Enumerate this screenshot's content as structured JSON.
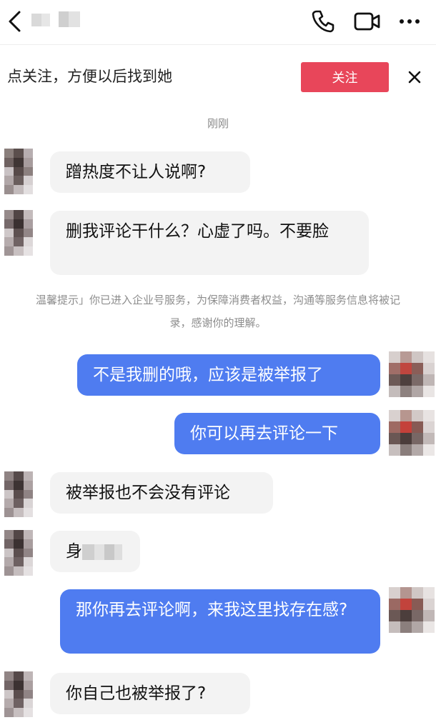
{
  "header": {
    "contact_name": "",
    "icons": [
      "back-icon",
      "phone-icon",
      "video-call-icon",
      "more-icon"
    ]
  },
  "follow_banner": {
    "text": "点关注，方便以后找到她",
    "button_label": "关注"
  },
  "timestamp": "刚刚",
  "messages": [
    {
      "side": "in",
      "text": "蹭热度不让人说啊?"
    },
    {
      "side": "in",
      "text": "删我评论干什么？心虚了吗。不要脸"
    },
    {
      "side": "out",
      "text": "不是我删的哦，应该是被举报了"
    },
    {
      "side": "out",
      "text": "你可以再去评论一下"
    },
    {
      "side": "in",
      "text": "被举报也不会没有评论"
    },
    {
      "side": "in",
      "text": "身"
    },
    {
      "side": "out",
      "text": "那你再去评论啊，来我这里找存在感?"
    },
    {
      "side": "in",
      "text": "你自己也被举报了?"
    }
  ],
  "system_notice": "温馨提示」你已进入企业号服务，为保障消费者权益，沟通等服务信息将被记录，感谢你的理解。",
  "colors": {
    "accent_follow": "#e8465a",
    "outgoing_bubble": "#4f7cf0",
    "incoming_bubble": "#f3f3f3"
  }
}
